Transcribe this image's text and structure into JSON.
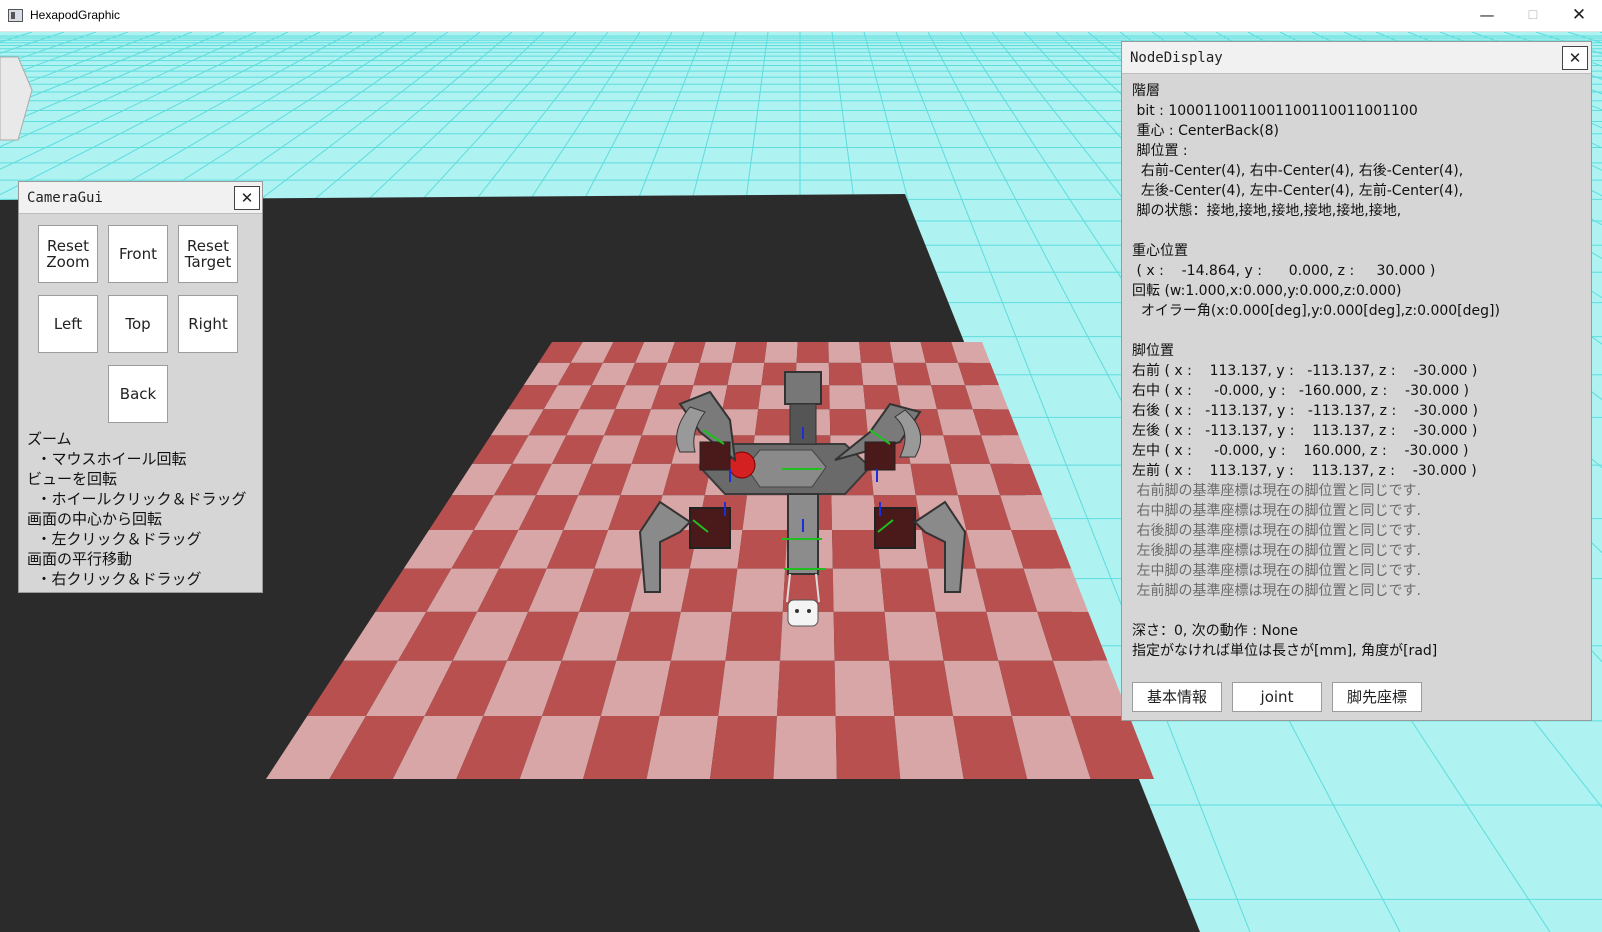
{
  "window": {
    "title": "HexapodGraphic",
    "minimize_glyph": "—",
    "maximize_glyph": "☐",
    "close_glyph": "✕"
  },
  "colors": {
    "sky": "#aef2f2",
    "grid_line": "#5fdcdc",
    "ground": "#2b2b2b",
    "checker_dark": "#b85050",
    "checker_light": "#d8a6a6",
    "panel_bg": "#d6d6d6"
  },
  "camera_gui": {
    "title": "CameraGui",
    "close": "✕",
    "buttons": {
      "reset_zoom": "Reset\nZoom",
      "front": "Front",
      "reset_target": "Reset\nTarget",
      "left": "Left",
      "top": "Top",
      "right": "Right",
      "back": "Back"
    },
    "help": [
      "ズーム",
      "  ・マウスホイール回転",
      "ビューを回転",
      "  ・ホイールクリック＆ドラッグ",
      "画面の中心から回転",
      "  ・左クリック＆ドラッグ",
      "画面の平行移動",
      "  ・右クリック＆ドラッグ"
    ]
  },
  "node_display": {
    "title": "NodeDisplay",
    "close": "✕",
    "lines": [
      "階層",
      " bit : 1000110011001100110011001100",
      " 重心 : CenterBack(8)",
      " 脚位置 :",
      "  右前-Center(4), 右中-Center(4), 右後-Center(4),",
      "  左後-Center(4), 左中-Center(4), 左前-Center(4),",
      " 脚の状態：接地,接地,接地,接地,接地,接地,",
      "",
      "重心位置",
      " ( x :    -14.864, y :      0.000, z :     30.000 )",
      "回転 (w:1.000,x:0.000,y:0.000,z:0.000)",
      "  オイラー角(x:0.000[deg],y:0.000[deg],z:0.000[deg])",
      "",
      "脚位置",
      "右前 ( x :    113.137, y :   -113.137, z :    -30.000 )",
      "右中 ( x :     -0.000, y :   -160.000, z :    -30.000 )",
      "右後 ( x :   -113.137, y :   -113.137, z :    -30.000 )",
      "左後 ( x :   -113.137, y :    113.137, z :    -30.000 )",
      "左中 ( x :     -0.000, y :    160.000, z :    -30.000 )",
      "左前 ( x :    113.137, y :    113.137, z :    -30.000 )"
    ],
    "grey_lines": [
      " 右前脚の基準座標は現在の脚位置と同じです.",
      " 右中脚の基準座標は現在の脚位置と同じです.",
      " 右後脚の基準座標は現在の脚位置と同じです.",
      " 左後脚の基準座標は現在の脚位置と同じです.",
      " 左中脚の基準座標は現在の脚位置と同じです.",
      " 左前脚の基準座標は現在の脚位置と同じです."
    ],
    "footer_lines": [
      "",
      "深さ：0, 次の動作 : None",
      "指定がなければ単位は長さが[mm], 角度が[rad]"
    ],
    "buttons": {
      "basic_info": "基本情報",
      "joint": "joint",
      "leg_tip": "脚先座標"
    }
  }
}
